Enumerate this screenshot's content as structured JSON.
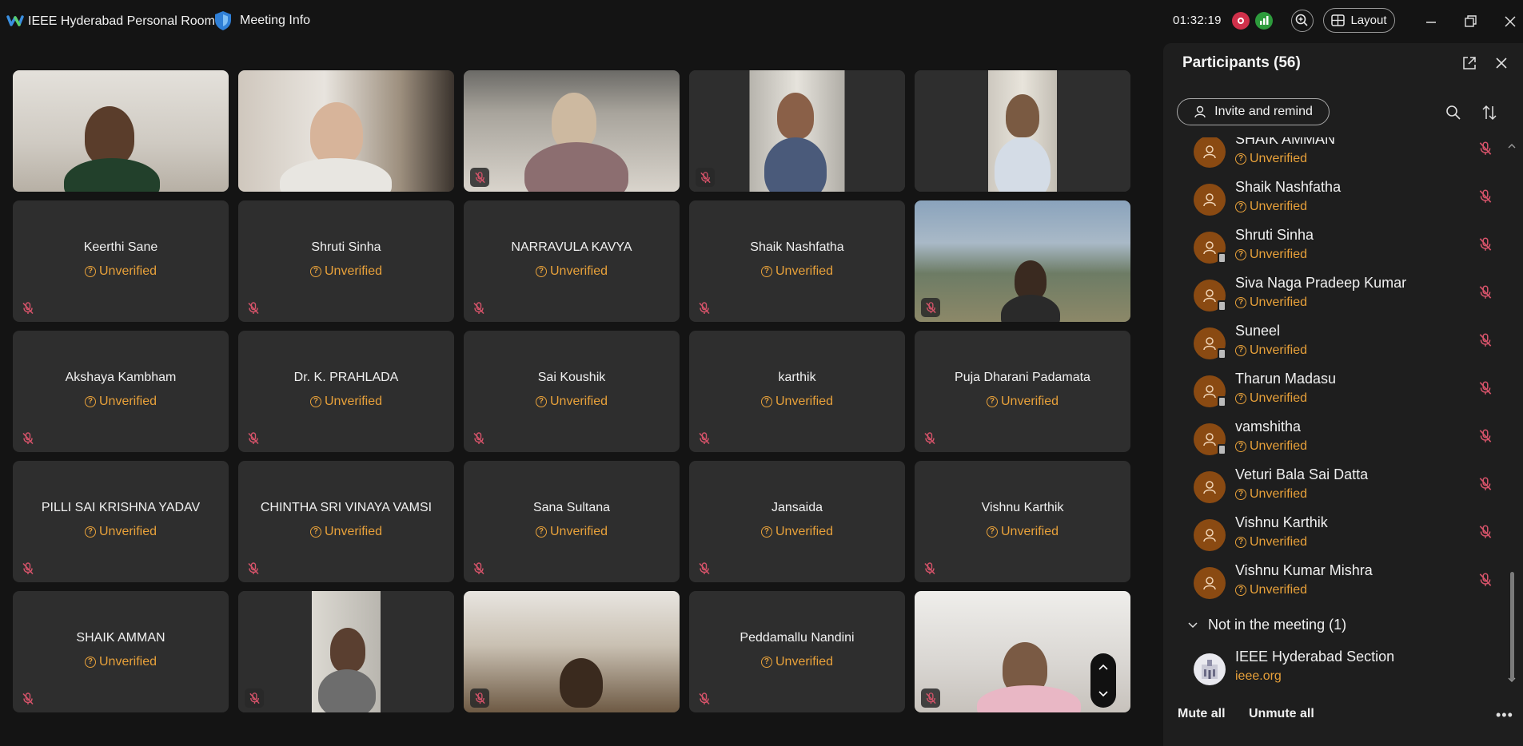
{
  "title_bar": {
    "app_title": "IEEE Hyderabad Personal Room",
    "meeting_info_label": "Meeting Info",
    "timer": "01:32:19",
    "layout_label": "Layout"
  },
  "colors": {
    "background": "#141414",
    "tile_bg": "#2e2e2e",
    "panel_bg": "#1e1e1e",
    "unverified": "#e8a13a",
    "mute_red": "#d0304a",
    "avatar_brown": "#8a4a12"
  },
  "tiles": [
    {
      "name": "",
      "status": "",
      "video": true
    },
    {
      "name": "",
      "status": "",
      "video": true
    },
    {
      "name": "",
      "status": "",
      "video": true
    },
    {
      "name": "",
      "status": "",
      "video": true
    },
    {
      "name": "",
      "status": "",
      "video": true
    },
    {
      "name": "Keerthi Sane",
      "status": "Unverified"
    },
    {
      "name": "Shruti Sinha",
      "status": "Unverified"
    },
    {
      "name": "NARRAVULA KAVYA",
      "status": "Unverified"
    },
    {
      "name": "Shaik Nashfatha",
      "status": "Unverified"
    },
    {
      "name": "",
      "status": "",
      "video": true
    },
    {
      "name": "Akshaya Kambham",
      "status": "Unverified"
    },
    {
      "name": "Dr. K. PRAHLADA",
      "status": "Unverified"
    },
    {
      "name": "Sai Koushik",
      "status": "Unverified"
    },
    {
      "name": "karthik",
      "status": "Unverified"
    },
    {
      "name": "Puja Dharani Padamata",
      "status": "Unverified"
    },
    {
      "name": "PILLI SAI KRISHNA YADAV",
      "status": "Unverified"
    },
    {
      "name": "CHINTHA SRI VINAYA VAMSI",
      "status": "Unverified"
    },
    {
      "name": "Sana Sultana",
      "status": "Unverified"
    },
    {
      "name": "Jansaida",
      "status": "Unverified"
    },
    {
      "name": "Vishnu Karthik",
      "status": "Unverified"
    },
    {
      "name": "SHAIK AMMAN",
      "status": "Unverified"
    },
    {
      "name": "",
      "status": "",
      "video": true
    },
    {
      "name": "",
      "status": "",
      "video": true
    },
    {
      "name": "Peddamallu Nandini",
      "status": "Unverified"
    },
    {
      "name": "",
      "status": "",
      "video": true
    }
  ],
  "panel": {
    "title": "Participants (56)",
    "invite_label": "Invite and remind",
    "participants": [
      {
        "name": "SHAIK AMMAN",
        "status": "Unverified"
      },
      {
        "name": "Shaik Nashfatha",
        "status": "Unverified"
      },
      {
        "name": "Shruti Sinha",
        "status": "Unverified"
      },
      {
        "name": "Siva Naga Pradeep Kumar",
        "status": "Unverified"
      },
      {
        "name": "Suneel",
        "status": "Unverified"
      },
      {
        "name": "Tharun Madasu",
        "status": "Unverified"
      },
      {
        "name": "vamshitha",
        "status": "Unverified"
      },
      {
        "name": "Veturi Bala Sai Datta",
        "status": "Unverified"
      },
      {
        "name": "Vishnu Karthik",
        "status": "Unverified"
      },
      {
        "name": "Vishnu Kumar Mishra",
        "status": "Unverified"
      }
    ],
    "not_in_meeting_label": "Not in the meeting (1)",
    "host": {
      "name": "IEEE Hyderabad Section",
      "sub": "ieee.org"
    },
    "mute_all_label": "Mute all",
    "unmute_all_label": "Unmute all"
  }
}
